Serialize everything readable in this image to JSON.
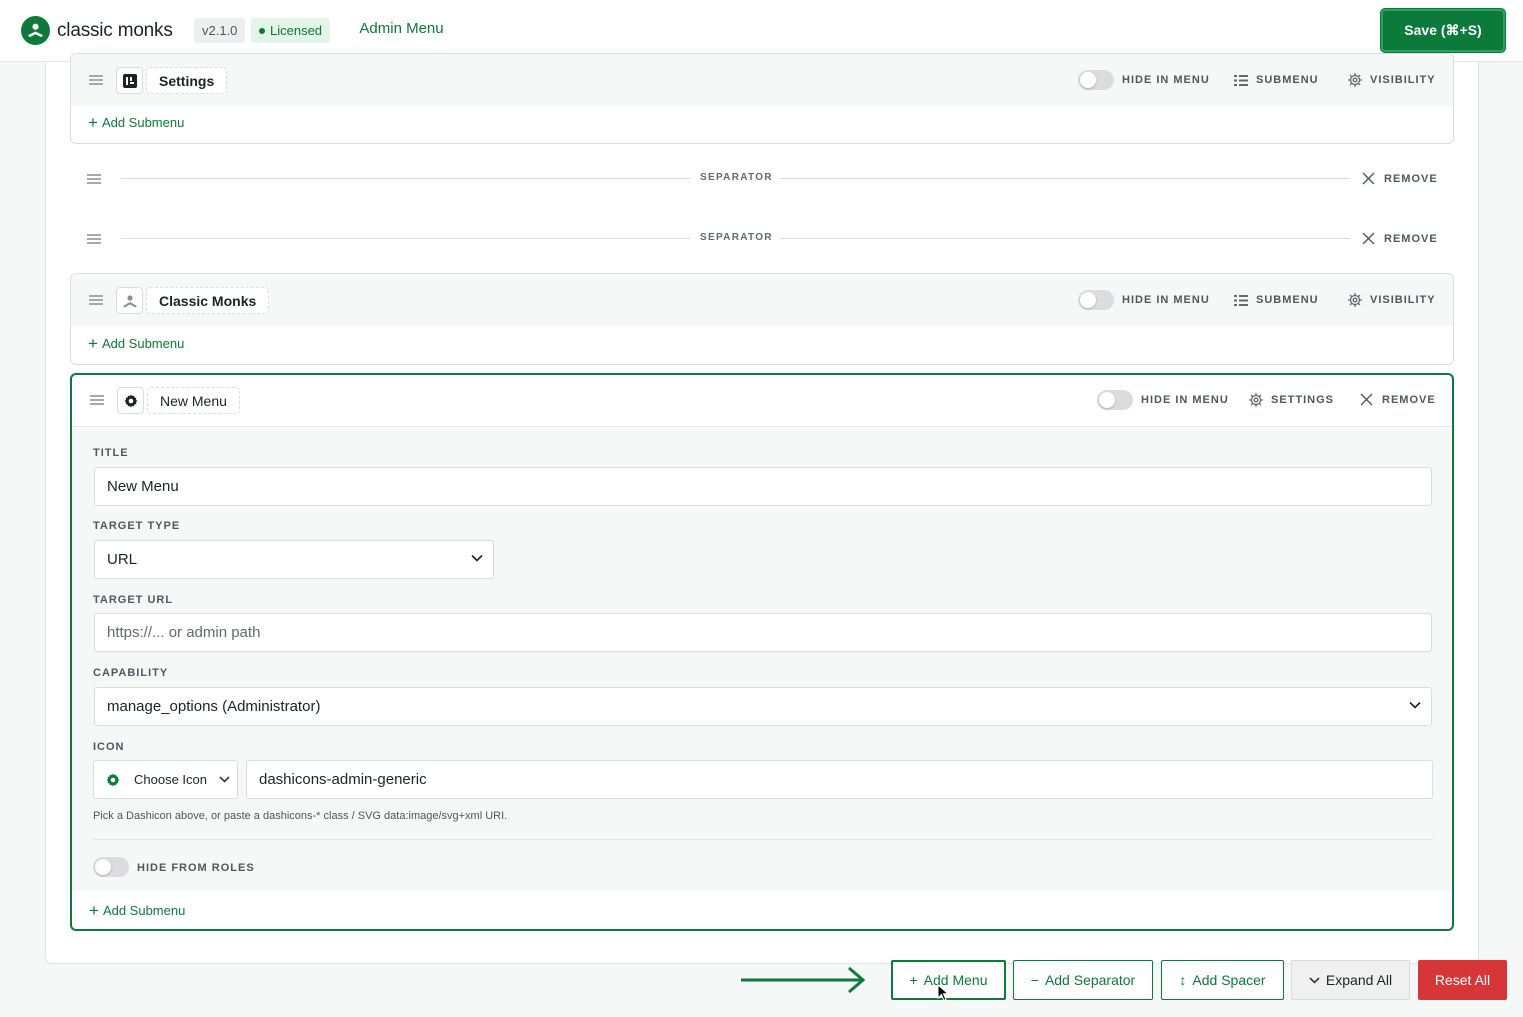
{
  "header": {
    "brand_name": "classic monks",
    "version": "v2.1.0",
    "license_status": "Licensed",
    "nav_tab": "Admin Menu",
    "save_label": "Save (⌘+S)"
  },
  "menu_items": {
    "settings": {
      "name": "Settings",
      "hide_in_menu": "HIDE IN MENU",
      "submenu": "SUBMENU",
      "visibility": "VISIBILITY",
      "add_submenu": "Add Submenu",
      "hidden": false
    },
    "separators": [
      {
        "label": "SEPARATOR",
        "remove": "REMOVE"
      },
      {
        "label": "SEPARATOR",
        "remove": "REMOVE"
      }
    ],
    "classic_monks": {
      "name": "Classic Monks",
      "hide_in_menu": "HIDE IN MENU",
      "submenu": "SUBMENU",
      "visibility": "VISIBILITY",
      "add_submenu": "Add Submenu",
      "hidden": false
    },
    "new_menu": {
      "name": "New Menu",
      "hide_in_menu": "HIDE IN MENU",
      "settings": "SETTINGS",
      "remove": "REMOVE",
      "hidden": false,
      "fields": {
        "title_label": "TITLE",
        "title_value": "New Menu",
        "target_type_label": "TARGET TYPE",
        "target_type_value": "URL",
        "target_url_label": "TARGET URL",
        "target_url_placeholder": "https://... or admin path",
        "capability_label": "CAPABILITY",
        "capability_value": "manage_options (Administrator)",
        "icon_label": "ICON",
        "choose_icon": "Choose Icon",
        "icon_value": "dashicons-admin-generic",
        "icon_help": "Pick a Dashicon above, or paste a dashicons-* class / SVG data:image/svg+xml URI.",
        "hide_from_roles": "HIDE FROM ROLES"
      },
      "add_submenu": "Add Submenu"
    }
  },
  "toolbar": {
    "add_menu": "Add Menu",
    "add_separator": "Add Separator",
    "add_spacer": "Add Spacer",
    "expand_all": "Expand All",
    "reset_all": "Reset All"
  },
  "colors": {
    "brand_green": "#0c7a3a",
    "danger_red": "#d63638"
  }
}
